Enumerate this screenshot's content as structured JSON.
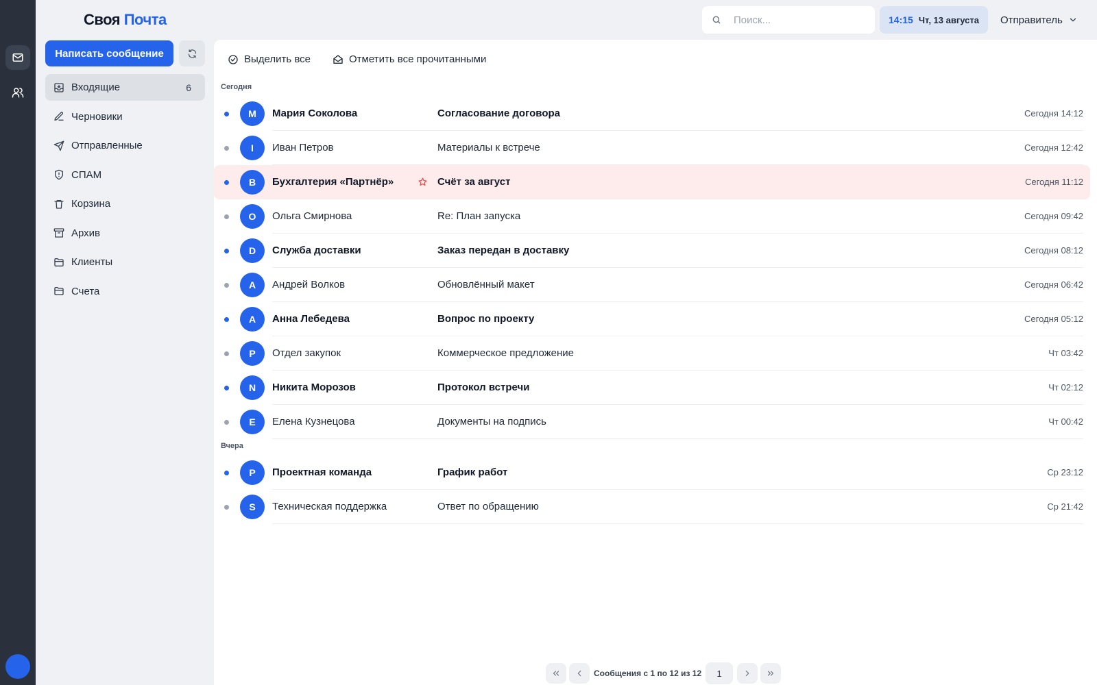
{
  "logo": {
    "part1": "Своя",
    "part2": "Почта"
  },
  "compose_label": "Написать сообщение",
  "folders": [
    {
      "label": "Входящие",
      "count": "6",
      "icon": "inbox-icon"
    },
    {
      "label": "Черновики",
      "icon": "edit-icon"
    },
    {
      "label": "Отправленные",
      "icon": "send-icon"
    },
    {
      "label": "СПАМ",
      "icon": "shield-alert-icon"
    },
    {
      "label": "Корзина",
      "icon": "trash-icon"
    },
    {
      "label": "Архив",
      "icon": "archive-icon"
    },
    {
      "label": "Клиенты",
      "icon": "folder-icon"
    },
    {
      "label": "Счета",
      "icon": "folder-icon"
    }
  ],
  "search": {
    "placeholder": "Поиск..."
  },
  "clock": {
    "time": "14:15",
    "date": "Чт, 13 августа"
  },
  "sender": {
    "label": "Отправитель"
  },
  "toolbar": {
    "select_all": "Выделить все",
    "mark_all_read": "Отметить все прочитанными"
  },
  "groups": [
    "Сегодня",
    "Вчера"
  ],
  "messages": [
    {
      "initial": "M",
      "from": "Мария Соколова",
      "subject": "Согласование договора",
      "time": "Сегодня 14:12",
      "unread": true
    },
    {
      "initial": "I",
      "from": "Иван Петров",
      "subject": "Материалы к встрече",
      "time": "Сегодня 12:42",
      "unread": false
    },
    {
      "initial": "B",
      "from": "Бухгалтерия «Партнёр»",
      "subject": "Счёт за август",
      "time": "Сегодня 11:12",
      "unread": true
    },
    {
      "initial": "O",
      "from": "Ольга Смирнова",
      "subject": "Re: План запуска",
      "time": "Сегодня 09:42",
      "unread": false
    },
    {
      "initial": "D",
      "from": "Служба доставки",
      "subject": "Заказ передан в доставку",
      "time": "Сегодня 08:12",
      "unread": true
    },
    {
      "initial": "A",
      "from": "Андрей Волков",
      "subject": "Обновлённый макет",
      "time": "Сегодня 06:42",
      "unread": false
    },
    {
      "initial": "A",
      "from": "Анна Лебедева",
      "subject": "Вопрос по проекту",
      "time": "Сегодня 05:12",
      "unread": true
    },
    {
      "initial": "P",
      "from": "Отдел закупок",
      "subject": "Коммерческое предложение",
      "time": "Чт 03:42",
      "unread": false
    },
    {
      "initial": "N",
      "from": "Никита Морозов",
      "subject": "Протокол встречи",
      "time": "Чт 02:12",
      "unread": true
    },
    {
      "initial": "E",
      "from": "Елена Кузнецова",
      "subject": "Документы на подпись",
      "time": "Чт 00:42",
      "unread": false
    },
    {
      "initial": "P",
      "from": "Проектная команда",
      "subject": "График работ",
      "time": "Ср 23:12",
      "unread": true
    },
    {
      "initial": "S",
      "from": "Техническая поддержка",
      "subject": "Ответ по обращению",
      "time": "Ср 21:42",
      "unread": false
    }
  ],
  "pagination": {
    "info": "Сообщения с 1 по 12 из 12",
    "current": "1"
  },
  "colors": {
    "accent": "#2563eb",
    "unread_dot": "#2563eb",
    "read_dot": "#9ca3af",
    "highlight_row": "#feecec",
    "star": "#ef4444",
    "rail": "#2a313c"
  }
}
